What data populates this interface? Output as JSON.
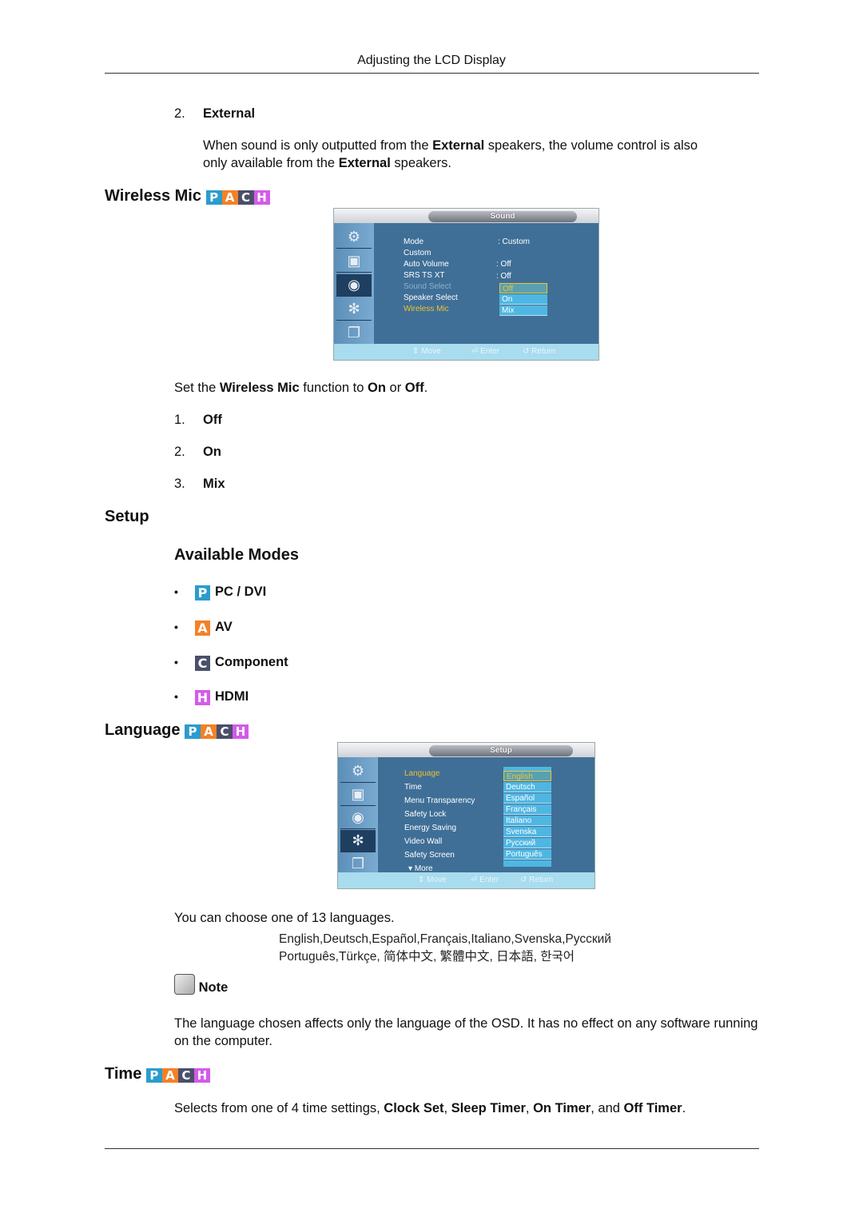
{
  "page_header": "Adjusting the LCD Display",
  "external": {
    "number": "2.",
    "title": "External",
    "desc_parts": [
      "When sound is only outputted from the ",
      "External",
      " speakers, the volume control is also",
      "only available from the ",
      "External",
      " speakers."
    ]
  },
  "wireless_mic": {
    "heading": "Wireless Mic",
    "badge": [
      "P",
      "A",
      "C",
      "H"
    ],
    "osd": {
      "tab": "Sound",
      "side_icons": [
        "input-icon",
        "picture-icon",
        "sound-icon",
        "setup-icon",
        "multi-control-icon"
      ],
      "items": [
        {
          "label": "Mode",
          "value": ": Custom",
          "state": "normal"
        },
        {
          "label": "Custom",
          "value": "",
          "state": "normal"
        },
        {
          "label": "Auto Volume",
          "value": ": Off",
          "state": "normal"
        },
        {
          "label": "SRS TS XT",
          "value": ": Off",
          "state": "normal"
        },
        {
          "label": "Sound Select",
          "value": ":",
          "state": "dim"
        },
        {
          "label": "Speaker Select",
          "value": ":",
          "state": "normal"
        },
        {
          "label": "Wireless Mic",
          "value": ":",
          "state": "highlight"
        }
      ],
      "options": [
        "Off",
        "On",
        "Mix"
      ],
      "selected_option": "Off",
      "footer": {
        "move": "Move",
        "enter": "Enter",
        "return": "Return"
      }
    },
    "desc_parts": [
      "Set the ",
      "Wireless Mic",
      " function to ",
      "On",
      " or ",
      "Off",
      "."
    ],
    "list": [
      {
        "n": "1.",
        "label": "Off"
      },
      {
        "n": "2.",
        "label": "On"
      },
      {
        "n": "3.",
        "label": "Mix"
      }
    ]
  },
  "setup": {
    "heading": "Setup",
    "available_modes_heading": "Available Modes",
    "modes": [
      {
        "letter": "P",
        "label": "PC / DVI",
        "color": "#2b9ccd"
      },
      {
        "letter": "A",
        "label": "AV",
        "color": "#f38127"
      },
      {
        "letter": "C",
        "label": "Component",
        "color": "#4a4f6a"
      },
      {
        "letter": "H",
        "label": "HDMI",
        "color": "#d35be8"
      }
    ]
  },
  "language": {
    "heading": "Language",
    "badge": [
      "P",
      "A",
      "C",
      "H"
    ],
    "osd": {
      "tab": "Setup",
      "items": [
        {
          "label": "Language",
          "value": ":",
          "state": "highlight"
        },
        {
          "label": "Time",
          "value": "",
          "state": "normal"
        },
        {
          "label": "Menu Transparency",
          "value": ":",
          "state": "normal"
        },
        {
          "label": "Safety Lock",
          "value": "",
          "state": "normal"
        },
        {
          "label": "Energy Saving",
          "value": ":",
          "state": "normal"
        },
        {
          "label": "Video Wall",
          "value": "",
          "state": "normal"
        },
        {
          "label": "Safety Screen",
          "value": "",
          "state": "normal"
        }
      ],
      "more": "More",
      "options": [
        "English",
        "Deutsch",
        "Español",
        "Français",
        "Italiano",
        "Svenska",
        "Русский",
        "Português"
      ],
      "selected_option": "English",
      "footer": {
        "move": "Move",
        "enter": "Enter",
        "return": "Return"
      }
    },
    "desc": "You can choose one of 13 languages.",
    "languages_line1": "English,Deutsch,Español,Français,Italiano,Svenska,Русский",
    "languages_line2": "Português,Türkçe, 简体中文,  繁體中文, 日本語, 한국어",
    "note_label": "Note",
    "note_text": "The language chosen affects only the language of the OSD. It has no effect on any software running on the computer."
  },
  "time": {
    "heading": "Time",
    "badge": [
      "P",
      "A",
      "C",
      "H"
    ],
    "desc_parts": [
      "Selects from one of 4 time settings, ",
      "Clock Set",
      ", ",
      "Sleep Timer",
      ", ",
      "On Timer",
      ", and ",
      "Off Timer",
      "."
    ]
  }
}
